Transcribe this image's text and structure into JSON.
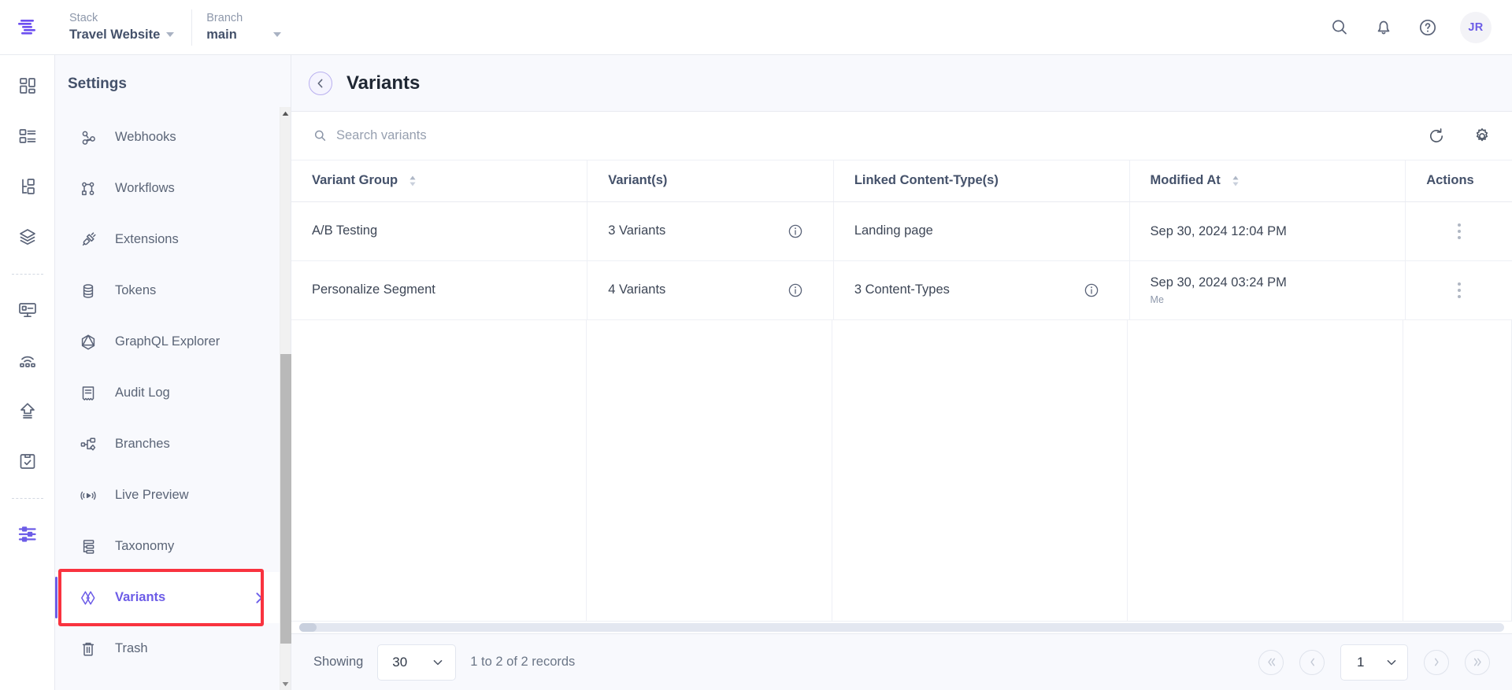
{
  "topbar": {
    "logo_icon": "contentstack-logo",
    "stack": {
      "label": "Stack",
      "value": "Travel Website"
    },
    "branch": {
      "label": "Branch",
      "value": "main"
    },
    "icons": [
      {
        "name": "search-icon"
      },
      {
        "name": "notifications-bell-icon"
      },
      {
        "name": "help-circle-icon"
      }
    ],
    "avatar_initials": "JR"
  },
  "rail": {
    "items": [
      {
        "name": "dashboard-icon"
      },
      {
        "name": "content-entries-icon"
      },
      {
        "name": "content-models-icon"
      },
      {
        "name": "assets-layers-icon"
      },
      {
        "name": "live-preview-monitor-icon"
      },
      {
        "name": "releases-icon"
      },
      {
        "name": "publish-queue-icon"
      },
      {
        "name": "tasks-clipboard-icon"
      },
      {
        "name": "settings-sliders-icon"
      }
    ]
  },
  "sidebar": {
    "title": "Settings",
    "items": [
      {
        "label": "Webhooks",
        "icon": "webhook-icon",
        "active": false
      },
      {
        "label": "Workflows",
        "icon": "workflow-icon",
        "active": false
      },
      {
        "label": "Extensions",
        "icon": "extensions-plug-icon",
        "active": false
      },
      {
        "label": "Tokens",
        "icon": "tokens-database-icon",
        "active": false
      },
      {
        "label": "GraphQL Explorer",
        "icon": "graphql-icon",
        "active": false
      },
      {
        "label": "Audit Log",
        "icon": "audit-log-icon",
        "active": false
      },
      {
        "label": "Branches",
        "icon": "branches-icon",
        "active": false
      },
      {
        "label": "Live Preview",
        "icon": "live-preview-icon",
        "active": false
      },
      {
        "label": "Taxonomy",
        "icon": "taxonomy-icon",
        "active": false
      },
      {
        "label": "Variants",
        "icon": "variants-icon",
        "active": true
      },
      {
        "label": "Trash",
        "icon": "trash-icon",
        "active": false
      }
    ],
    "annotation_color": "#f9333f"
  },
  "page": {
    "back_icon": "chevron-left-icon",
    "title": "Variants"
  },
  "toolbar": {
    "search_placeholder": "Search variants",
    "search_value": "",
    "search_icon": "search-icon",
    "refresh_icon": "refresh-icon",
    "settings_icon": "gear-icon"
  },
  "table": {
    "columns": [
      {
        "label": "Variant Group",
        "sortable": true
      },
      {
        "label": "Variant(s)",
        "sortable": false
      },
      {
        "label": "Linked Content-Type(s)",
        "sortable": false
      },
      {
        "label": "Modified At",
        "sortable": true
      },
      {
        "label": "Actions",
        "sortable": false
      }
    ],
    "rows": [
      {
        "variant_group": "A/B Testing",
        "variants": "3 Variants",
        "variants_info": true,
        "linked_content_types": "Landing page",
        "linked_info": false,
        "modified_at": "Sep 30, 2024 12:04 PM",
        "modified_by": "",
        "actions_icon": "kebab-menu-icon"
      },
      {
        "variant_group": "Personalize Segment",
        "variants": "4 Variants",
        "variants_info": true,
        "linked_content_types": "3 Content-Types",
        "linked_info": true,
        "modified_at": "Sep 30, 2024 03:24 PM",
        "modified_by": "Me",
        "actions_icon": "kebab-menu-icon"
      }
    ]
  },
  "pagination": {
    "showing_label": "Showing",
    "page_size": "30",
    "records_text": "1 to 2 of 2 records",
    "first_icon": "double-chevron-left-icon",
    "prev_icon": "chevron-left-icon",
    "current_page": "1",
    "next_icon": "chevron-right-icon",
    "last_icon": "double-chevron-right-icon"
  },
  "colors": {
    "accent": "#6c5ce7",
    "annotation": "#f9333f",
    "panel_bg": "#f8f9fd",
    "text": "#44516a"
  }
}
